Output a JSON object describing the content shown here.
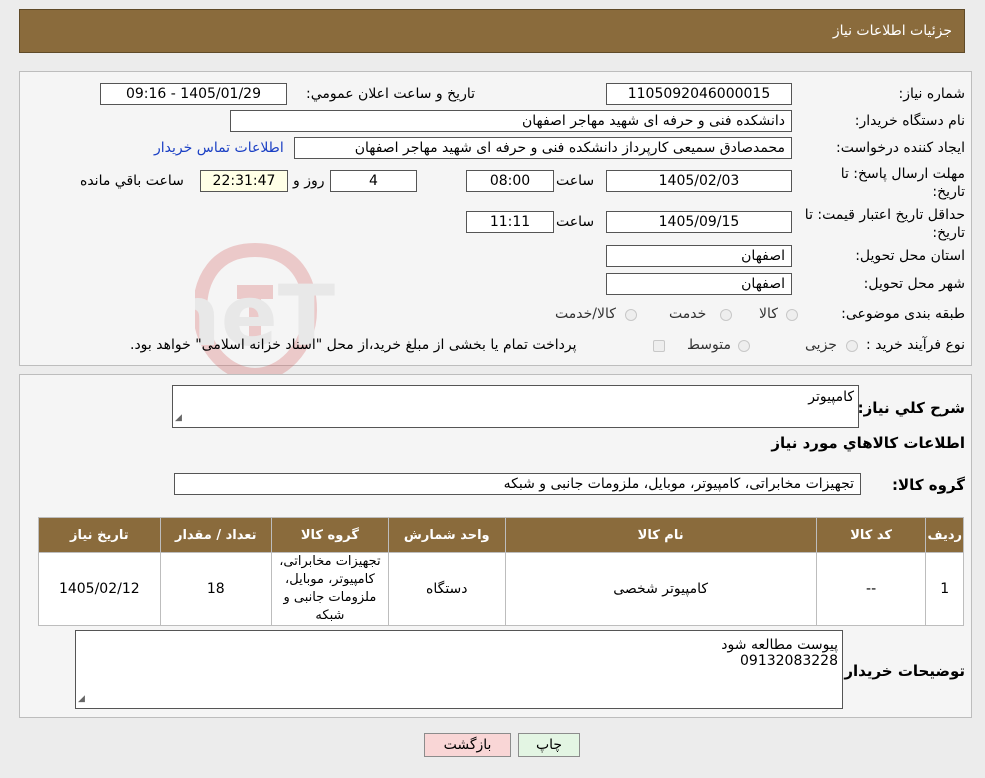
{
  "header": {
    "title": "جزئیات اطلاعات نیاز"
  },
  "watermark": {
    "brand": "AriaTender.neT"
  },
  "form": {
    "need_number": {
      "label": "شماره نیاز:",
      "value": "1105092046000015"
    },
    "announce_datetime": {
      "label": "تاريخ و ساعت اعلان عمومي:",
      "value": "1405/01/29 - 09:16"
    },
    "buyer_org": {
      "label": "نام دستگاه خريدار:",
      "value": "دانشکده فنی و حرفه ای شهید مهاجر اصفهان"
    },
    "requester": {
      "label": "ایجاد کننده درخواست:",
      "value": "محمدصادق سمیعی کارپرداز دانشکده فنی و حرفه ای شهید مهاجر اصفهان"
    },
    "contact_link": "اطلاعات تماس خریدار",
    "reply_deadline": {
      "label": "مهلت ارسال پاسخ: تا تاریخ:",
      "date": "1405/02/03",
      "time_label": "ساعت",
      "time": "08:00",
      "days": "4",
      "days_label": "روز و",
      "remaining": "22:31:47",
      "remaining_label": "ساعت باقي مانده"
    },
    "price_validity": {
      "label": "حداقل تاریخ اعتبار قیمت: تا تاریخ:",
      "date": "1405/09/15",
      "time_label": "ساعت",
      "time": "11:11"
    },
    "province": {
      "label": "استان محل تحویل:",
      "value": "اصفهان"
    },
    "city": {
      "label": "شهر محل تحویل:",
      "value": "اصفهان"
    },
    "category": {
      "label": "طبقه بندی موضوعی:",
      "options": [
        "کالا",
        "خدمت",
        "کالا/خدمت"
      ]
    },
    "purchase_type": {
      "label": "نوع فرآیند خرید :",
      "options": [
        "جزیی",
        "متوسط"
      ],
      "note": "پرداخت تمام یا بخشی از مبلغ خرید،از محل \"اسناد خزانه اسلامی\" خواهد بود."
    }
  },
  "details": {
    "summary_label": "شرح کلي نياز:",
    "summary_value": "کامپیوتر",
    "goods_section_title": "اطلاعات کالاهاي مورد نياز",
    "goods_group_label": "گروه کالا:",
    "goods_group_value": "تجهیزات مخابراتی، کامپیوتر، موبایل، ملزومات جانبی و شبکه",
    "table": {
      "headers": [
        "رديف",
        "کد کالا",
        "نام کالا",
        "واحد شمارش",
        "گروه کالا",
        "تعداد / مقدار",
        "تاریخ نیاز"
      ],
      "rows": [
        [
          "1",
          "--",
          "کامپیوتر شخصی",
          "دستگاه",
          "تجهیزات مخابراتی، کامپیوتر، موبایل، ملزومات جانبی و شبکه",
          "18",
          "1405/02/12"
        ]
      ]
    },
    "buyer_notes_label": "توضیحات خریدار:",
    "buyer_notes_line1": "پیوست مطالعه شود",
    "buyer_notes_line2": "09132083228"
  },
  "buttons": {
    "print": "چاپ",
    "back": "بازگشت"
  },
  "colors": {
    "header": "#8a6b3c",
    "link": "#1a3fc4",
    "back_button": "#f9d6d6",
    "print_button": "#e3f5e3"
  }
}
